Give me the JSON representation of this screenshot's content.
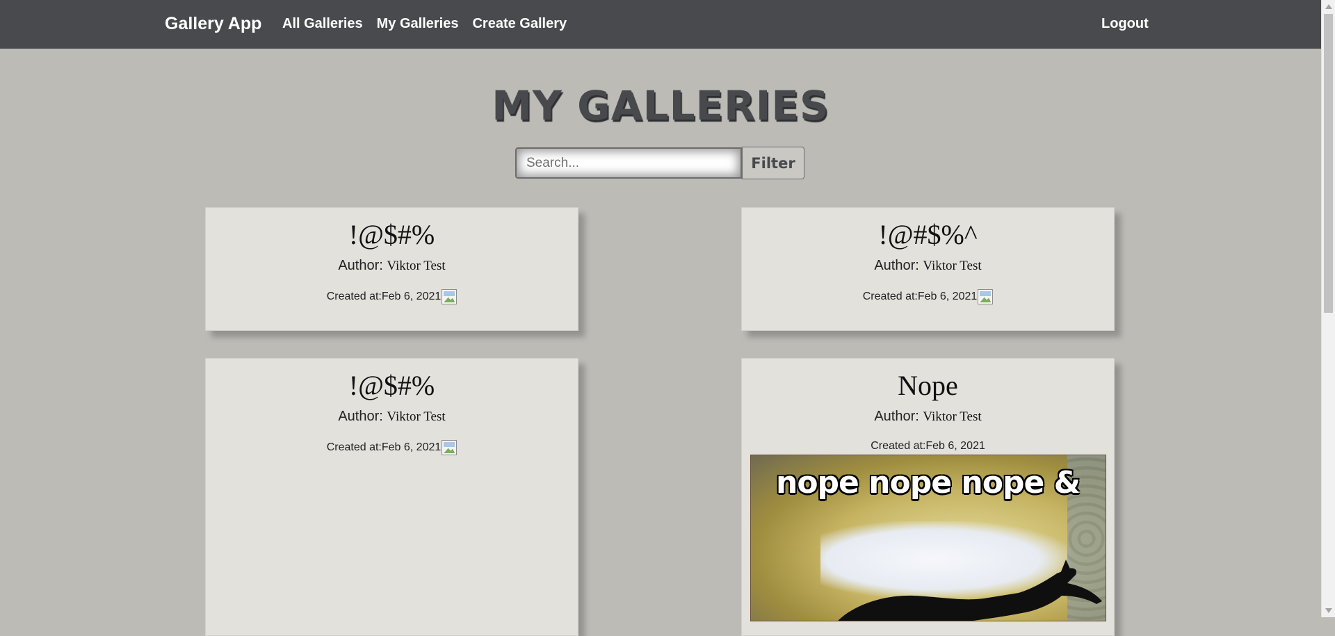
{
  "nav": {
    "brand": "Gallery App",
    "links": [
      "All Galleries",
      "My Galleries",
      "Create Gallery"
    ],
    "logout": "Logout"
  },
  "page": {
    "title": "MY GALLERIES"
  },
  "search": {
    "placeholder": "Search...",
    "value": "",
    "button": "Filter"
  },
  "galleries": [
    {
      "title": "!@$#%",
      "author_label": "Author: ",
      "author": "Viktor Test",
      "created_label": "Created at: ",
      "created": "Feb 6, 2021"
    },
    {
      "title": "!@#$%^",
      "author_label": "Author: ",
      "author": "Viktor Test",
      "created_label": "Created at: ",
      "created": "Feb 6, 2021"
    },
    {
      "title": "!@$#%",
      "author_label": "Author: ",
      "author": "Viktor Test",
      "created_label": "Created at: ",
      "created": "Feb 6, 2021"
    },
    {
      "title": "Nope",
      "author_label": "Author: ",
      "author": "Viktor Test",
      "created_label": "Created at: ",
      "created": "Feb 6, 2021",
      "image_caption": "nope nope nope &"
    }
  ]
}
